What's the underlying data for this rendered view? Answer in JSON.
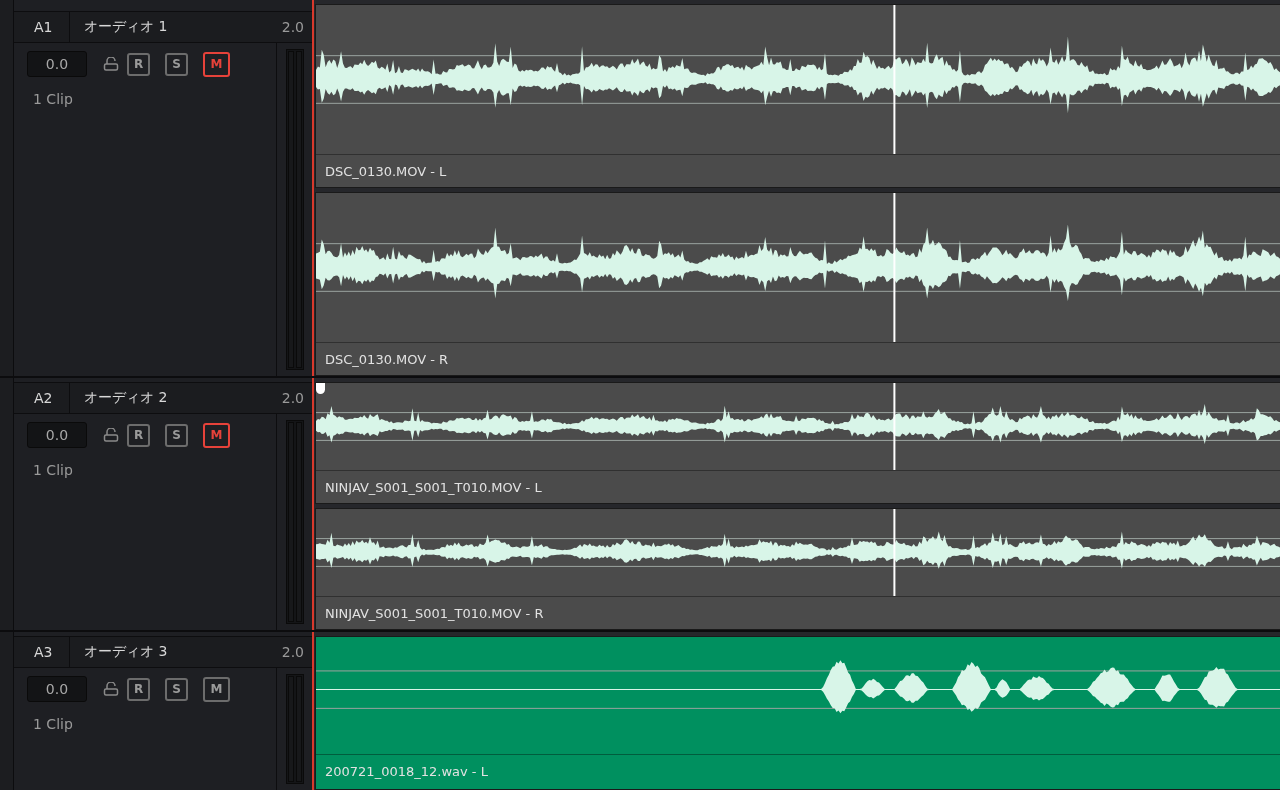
{
  "tracks": [
    {
      "id": "A1",
      "name": "オーディオ 1",
      "format": "2.0",
      "volume": "0.0",
      "locked": false,
      "clip_count": "1 Clip",
      "meters": [
        {
          "level": 0
        },
        {
          "level": 0
        }
      ],
      "buttons": [
        {
          "kind": "record",
          "label": "R",
          "on": false
        },
        {
          "kind": "solo",
          "label": "S",
          "on": false
        },
        {
          "kind": "mute",
          "label": "M",
          "on": true
        }
      ],
      "clips": [
        {
          "name": "DSC_0130.MOV - L",
          "color": "#4b4b4b",
          "fade_handle": false
        },
        {
          "name": "DSC_0130.MOV - R",
          "color": "#4b4b4b",
          "fade_handle": false
        }
      ]
    },
    {
      "id": "A2",
      "name": "オーディオ 2",
      "format": "2.0",
      "volume": "0.0",
      "locked": false,
      "clip_count": "1 Clip",
      "meters": [
        {
          "level": 0
        },
        {
          "level": 0
        }
      ],
      "buttons": [
        {
          "kind": "record",
          "label": "R",
          "on": false
        },
        {
          "kind": "solo",
          "label": "S",
          "on": false
        },
        {
          "kind": "mute",
          "label": "M",
          "on": true
        }
      ],
      "clips": [
        {
          "name": "NINJAV_S001_S001_T010.MOV - L",
          "color": "#4b4b4b",
          "fade_handle": true
        },
        {
          "name": "NINJAV_S001_S001_T010.MOV - R",
          "color": "#4b4b4b",
          "fade_handle": false
        }
      ]
    },
    {
      "id": "A3",
      "name": "オーディオ 3",
      "format": "2.0",
      "volume": "0.0",
      "locked": false,
      "clip_count": "1 Clip",
      "meters": [
        {
          "level": 0
        },
        {
          "level": 0
        }
      ],
      "buttons": [
        {
          "kind": "record",
          "label": "R",
          "on": false
        },
        {
          "kind": "solo",
          "label": "S",
          "on": false
        },
        {
          "kind": "mute",
          "label": "M",
          "on": false
        }
      ],
      "clips": [
        {
          "name": "200721_0018_12.wav - L",
          "color": "#00905f",
          "fade_handle": false
        }
      ]
    }
  ]
}
